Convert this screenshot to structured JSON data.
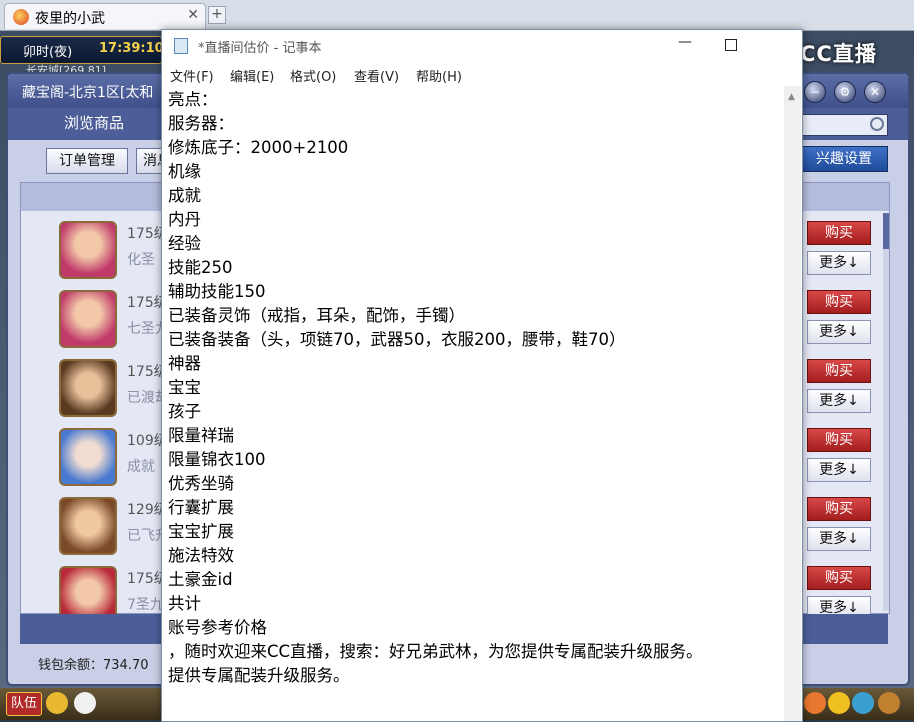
{
  "browser": {
    "tab_title": "夜里的小武",
    "tab_close": "✕",
    "new_tab": "+"
  },
  "hud": {
    "time_label": "卯时(夜)",
    "clock": "17:39:10",
    "location": "长安城[269,81]"
  },
  "overlay": {
    "logo_text": "CC直播"
  },
  "shop": {
    "title": "藏宝阁-北京1区[太和",
    "browse_tab": "浏览商品",
    "order_button": "订单管理",
    "message_button": "消息",
    "interest_button": "兴趣设置",
    "wallet": "钱包余额：734.70",
    "buy_label": "购买",
    "more_label": "更多↓",
    "items": [
      {
        "level": "175级",
        "desc": "化圣"
      },
      {
        "level": "175级",
        "desc": "七圣九"
      },
      {
        "level": "175级",
        "desc": "已渡劫"
      },
      {
        "level": "109级",
        "desc": "成就"
      },
      {
        "level": "129级",
        "desc": "已飞升"
      },
      {
        "level": "175级",
        "desc": "7圣九"
      }
    ]
  },
  "game_bottom": {
    "team": "队伍"
  },
  "notepad": {
    "title": "*直播间估价 - 记事本",
    "min": "—",
    "menu": [
      "文件(F)",
      "编辑(E)",
      "格式(O)",
      "查看(V)",
      "帮助(H)"
    ],
    "content": "亮点：\n服务器：\n修炼底子：2000+2100\n机缘\n成就\n内丹\n经验\n技能250\n辅助技能150\n已装备灵饰（戒指，耳朵，配饰，手镯）\n已装备装备（头，项链70，武器50，衣服200，腰带，鞋70）\n神器\n宝宝\n孩子\n限量祥瑞\n限量锦衣100\n优秀坐骑\n行囊扩展\n宝宝扩展\n施法特效\n土豪金id\n共计\n账号参考价格\n，随时欢迎来CC直播，搜索：好兄弟武林，为您提供专属配装升级服务。\n提供专属配装升级服务。"
  },
  "colors": {
    "buy_red": "#c02a2a",
    "panel_blue": "#4c5d98"
  }
}
